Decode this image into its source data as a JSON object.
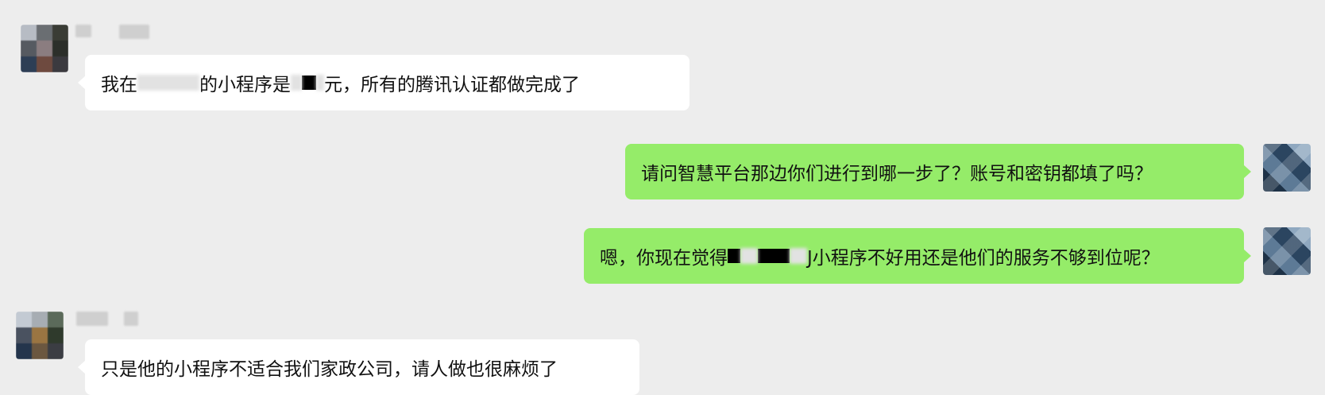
{
  "messages": [
    {
      "side": "left",
      "sender_name": "",
      "avatar": "blurred-contact-avatar",
      "text": {
        "part1": "我在",
        "part2": "的小程序是",
        "part3": "元，所有的腾讯认证都做完成了"
      }
    },
    {
      "side": "right",
      "avatar": "blue-tile-avatar",
      "text": "请问智慧平台那边你们进行到哪一步了？账号和密钥都填了吗？"
    },
    {
      "side": "right",
      "avatar": "blue-tile-avatar",
      "text": {
        "part1": "嗯，你现在觉得",
        "part2": "J小程序不好用还是他们的服务不够到位呢？"
      }
    },
    {
      "side": "left",
      "sender_name": "",
      "avatar": "blurred-contact-avatar",
      "text": "只是他的小程序不适合我们家政公司，请人做也很麻烦了"
    }
  ],
  "colors": {
    "background": "#ededed",
    "incoming_bubble": "#ffffff",
    "outgoing_bubble": "#95ec69",
    "text": "#111111"
  }
}
